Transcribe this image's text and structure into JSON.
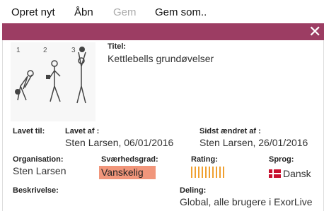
{
  "menu": {
    "new": "Opret nyt",
    "open": "Åbn",
    "save": "Gem",
    "save_as": "Gem som.."
  },
  "dialog": {
    "close_glyph": "✕"
  },
  "thumb": {
    "step_labels": [
      "1",
      "2",
      "3"
    ]
  },
  "details": {
    "title_label": "Titel:",
    "title_value": "Kettlebells grundøvelser",
    "made_until_label": "Lavet til:",
    "made_by_label": "Lavet af :",
    "made_by_value": "Sten Larsen, 06/01/2016",
    "last_changed_label": "Sidst ændret af :",
    "last_changed_value": "Sten Larsen, 26/01/2016",
    "organisation_label": "Organisation:",
    "organisation_value": "Sten Larsen",
    "difficulty_label": "Sværhedsgrad:",
    "difficulty_value": "Vanskelig",
    "rating_label": "Rating:",
    "rating_value": 10,
    "language_label": "Sprog:",
    "language_value": "Dansk",
    "description_label": "Beskrivelse:",
    "sharing_label": "Deling:",
    "sharing_value": "Global, alle brugere i ExorLive"
  },
  "colors": {
    "titlebar": "#9c3d63",
    "difficulty_badge": "#f1967b",
    "rating_bar": "#f0a030"
  }
}
